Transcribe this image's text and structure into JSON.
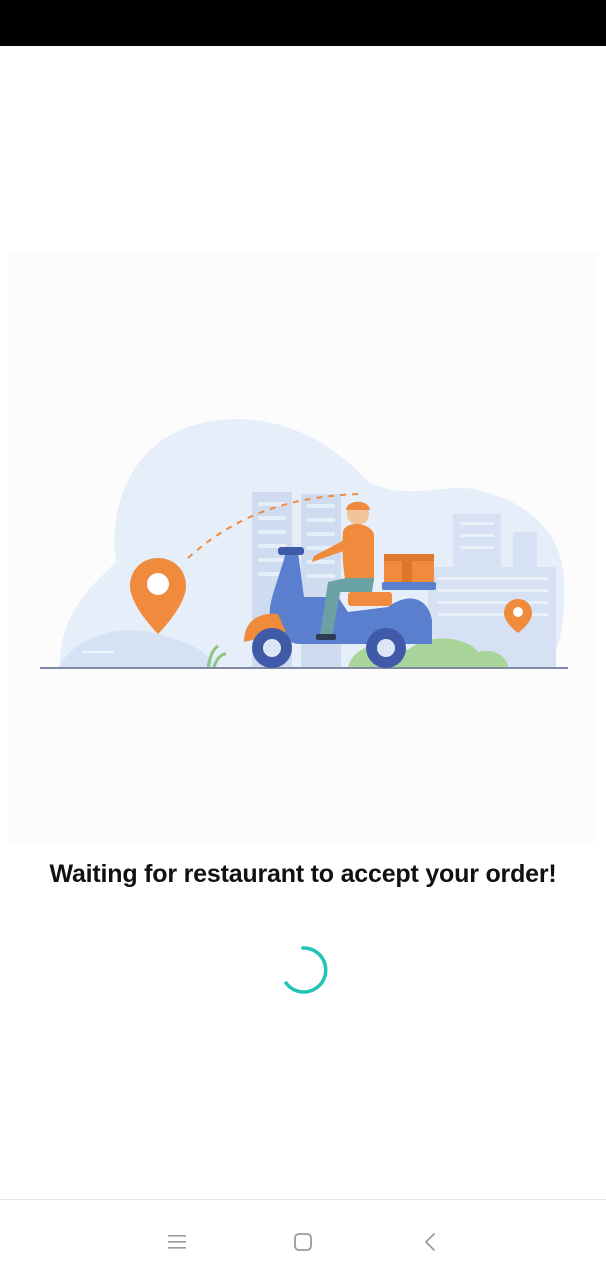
{
  "screen": {
    "message": "Waiting for restaurant to accept your order!"
  },
  "illustration": {
    "subject": "delivery-scooter-rider",
    "colors": {
      "accent_orange": "#f08a3c",
      "scooter_blue": "#5b7fcf",
      "backdrop_blue": "#e6eefa",
      "building_blue": "#cfdcf0",
      "bush_green": "#a9d49a"
    }
  },
  "spinner": {
    "color": "#20c4b4"
  },
  "nav": {
    "menu_icon": "menu-icon",
    "home_icon": "home-icon",
    "back_icon": "back-icon"
  }
}
